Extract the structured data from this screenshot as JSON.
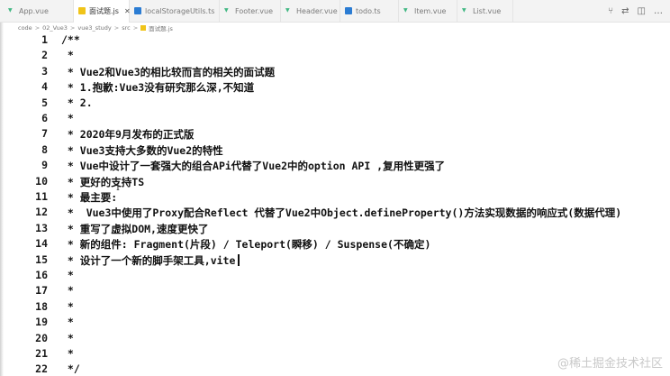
{
  "tabs": [
    {
      "label": "App.vue",
      "icon": "vue-file-icon",
      "active": false
    },
    {
      "label": "面试题.js",
      "icon": "js-file-icon",
      "active": true
    },
    {
      "label": "localStorageUtils.ts",
      "icon": "ts-file-icon",
      "active": false
    },
    {
      "label": "Footer.vue",
      "icon": "vue-file-icon",
      "active": false
    },
    {
      "label": "Header.vue",
      "icon": "vue-file-icon",
      "active": false
    },
    {
      "label": "todo.ts",
      "icon": "ts-file-icon",
      "active": false
    },
    {
      "label": "Item.vue",
      "icon": "vue-file-icon",
      "active": false
    },
    {
      "label": "List.vue",
      "icon": "vue-file-icon",
      "active": false
    }
  ],
  "tab_actions": [
    "⑂",
    "⇄",
    "◫",
    "…"
  ],
  "breadcrumb": [
    "code",
    "02_Vue3",
    "vue3_study",
    "src",
    "面试题.js"
  ],
  "breadcrumb_separator": ">",
  "lines": [
    {
      "n": "1",
      "text": "/**"
    },
    {
      "n": "2",
      "text": " *"
    },
    {
      "n": "3",
      "text": " * Vue2和Vue3的相比较而言的相关的面试题"
    },
    {
      "n": "4",
      "text": " * 1.抱歉:Vue3没有研究那么深,不知道"
    },
    {
      "n": "5",
      "text": " * 2."
    },
    {
      "n": "6",
      "text": " *"
    },
    {
      "n": "7",
      "text": " * 2020年9月发布的正式版"
    },
    {
      "n": "8",
      "text": " * Vue3支持大多数的Vue2的特性"
    },
    {
      "n": "9",
      "text": " * Vue中设计了一套强大的组合APi代替了Vue2中的option API ,复用性更强了"
    },
    {
      "n": "10",
      "text": " * 更好的支持TS"
    },
    {
      "n": "11",
      "text": " * 最主要:"
    },
    {
      "n": "12",
      "text": " *  Vue3中使用了Proxy配合Reflect 代替了Vue2中Object.defineProperty()方法实现数据的响应式(数据代理)"
    },
    {
      "n": "13",
      "text": " * 重写了虚拟DOM,速度更快了"
    },
    {
      "n": "14",
      "text": " * 新的组件: Fragment(片段) / Teleport(瞬移) / Suspense(不确定)"
    },
    {
      "n": "15",
      "text": " * 设计了一个新的脚手架工具,vite"
    },
    {
      "n": "16",
      "text": " *"
    },
    {
      "n": "17",
      "text": " *"
    },
    {
      "n": "18",
      "text": " *"
    },
    {
      "n": "19",
      "text": " *"
    },
    {
      "n": "20",
      "text": " *"
    },
    {
      "n": "21",
      "text": " *"
    },
    {
      "n": "22",
      "text": " */"
    }
  ],
  "cursor_line": "15",
  "watermark": "@稀土掘金技术社区"
}
